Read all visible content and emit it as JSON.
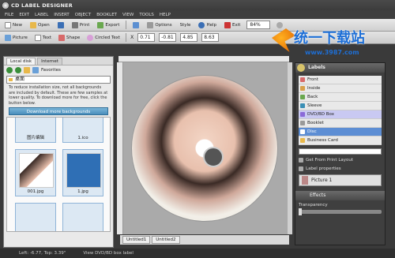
{
  "app": {
    "title": "CD LABEL DESIGNER"
  },
  "menu": [
    "FILE",
    "EDIT",
    "LABEL",
    "INSERT",
    "OBJECT",
    "BOOKLET",
    "VIEW",
    "TOOLS",
    "HELP"
  ],
  "toolbar1": {
    "new": "New",
    "open": "Open",
    "print": "Print",
    "export": "Export",
    "options": "Options",
    "style": "Style",
    "help": "Help",
    "exit": "Exit",
    "zoom": "84%"
  },
  "toolbar2": {
    "picture": "Picture",
    "text": "Text",
    "shape": "Shape",
    "circled": "Circled Text",
    "x_label": "X",
    "x": "0.71",
    "y": "-0.81",
    "w": "4.85",
    "h": "8.63"
  },
  "left": {
    "tabs": [
      "Local disk",
      "Internet"
    ],
    "favorites": "Favorites",
    "folder": "桌面",
    "info": "To reduce installation size, not all backgrounds are included by default. These are few samples at lower quality. To download more for free, click the button below.",
    "download": "Download more backgrounds",
    "thumbs": [
      "图片编辑",
      "1.ico",
      "001.jpg",
      "1.jpg"
    ]
  },
  "watermark": {
    "main": "统一下载站",
    "url": "www.3987.com"
  },
  "doc": {
    "tabs": [
      "Untitled1",
      "Untitled2"
    ]
  },
  "right": {
    "labels_title": "Labels",
    "labels": [
      "Front",
      "Inside",
      "Back",
      "Sleeve",
      "DVD/BD Box",
      "Booklet",
      "Disc",
      "Business Card"
    ],
    "get_from": "Get From Print Layout",
    "label_props": "Label properties",
    "picture": "Picture 1",
    "effects": "Effects",
    "transparency": "Transparency"
  },
  "status": {
    "pos": "Left: -6.77, Top: 3.39\"",
    "view": "View DVD/BD box label"
  },
  "colors": {
    "sel": "#5d8ed4",
    "sel2": "#c9c9f2",
    "accent": "#1e6fd6"
  }
}
